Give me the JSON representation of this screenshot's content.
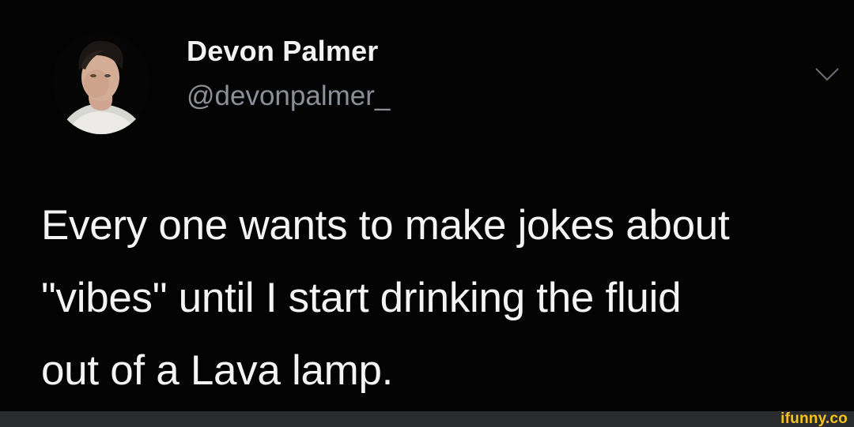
{
  "tweet": {
    "display_name": "Devon Palmer",
    "handle": "@devonpalmer_",
    "text": "Every one wants to make jokes about\n\"vibes\" until  I start drinking the fluid\nout of a Lava lamp.",
    "menu_icon": "chevron-down-icon"
  },
  "footer": {
    "watermark": "ifunny.co"
  },
  "colors": {
    "background": "#000000",
    "name": "#f2f2f2",
    "handle": "#8a9096",
    "watermark": "#f7c21b"
  }
}
